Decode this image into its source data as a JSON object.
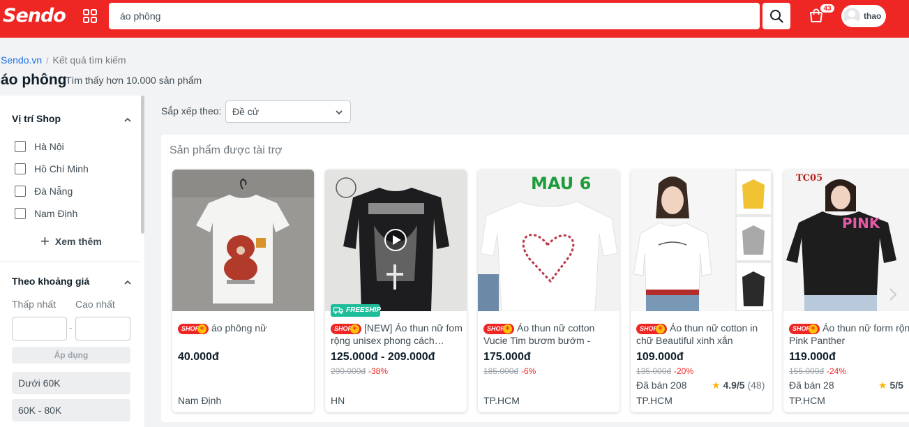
{
  "header": {
    "logo": "Sendo",
    "search_value": "áo phông",
    "cart_count": "43",
    "user_name": "thao"
  },
  "breadcrumb": {
    "home": "Sendo.vn",
    "sep": "/",
    "current": "Kết quả tìm kiếm"
  },
  "page": {
    "title": "áo phông",
    "result_count": "Tìm thấy hơn 10.000 sản phẩm"
  },
  "sidebar": {
    "location_title": "Vị trí Shop",
    "locations": [
      "Hà Nội",
      "Hồ Chí Minh",
      "Đà Nẵng",
      "Nam Định"
    ],
    "see_more": "Xem thêm",
    "price_title": "Theo khoảng giá",
    "min_label": "Thấp nhất",
    "max_label": "Cao nhất",
    "dash": "-",
    "apply": "Áp dụng",
    "ranges": [
      "Dưới 60K",
      "60K - 80K"
    ]
  },
  "sort": {
    "label": "Sắp xếp theo:",
    "value": "Đề cử"
  },
  "sponsored": {
    "title": "Sản phẩm được tài trợ",
    "shop_badge": "SHOP",
    "freeship": "FREESHIP",
    "products": [
      {
        "name": "áo phông nữ",
        "price": "40.000đ",
        "old_price": "",
        "discount": "",
        "sold": "",
        "rating": "",
        "reviews": "",
        "location": "Nam Định"
      },
      {
        "name": "[NEW] Áo thun nữ fom rộng unisex phong cách…",
        "price": "125.000đ - 209.000đ",
        "old_price": "290.000đ",
        "discount": "-38%",
        "sold": "",
        "rating": "",
        "reviews": "",
        "location": "HN"
      },
      {
        "name": "Áo thun nữ cotton Vucie Tim bươm bướm - Siz…",
        "price": "175.000đ",
        "old_price": "185.000đ",
        "discount": "-6%",
        "sold": "",
        "rating": "",
        "reviews": "",
        "location": "TP.HCM"
      },
      {
        "name": "Áo thun nữ cotton in chữ Beautiful xinh xắn",
        "price": "109.000đ",
        "old_price": "135.000đ",
        "discount": "-20%",
        "sold": "Đã bán 208",
        "rating": "4.9/5",
        "reviews": "(48)",
        "location": "TP.HCM"
      },
      {
        "name": "Áo thun nữ form rộng Pink Panther",
        "price": "119.000đ",
        "old_price": "155.000đ",
        "discount": "-24%",
        "sold": "Đã bán 28",
        "rating": "5/5",
        "reviews": "",
        "location": "TP.HCM"
      }
    ],
    "image_texts": {
      "p3": "MAU 6",
      "p5_code": "TC05",
      "p5_print": "PINK"
    }
  },
  "colors": {
    "brand": "#ee2624",
    "freeship": "#1dbd9a",
    "star": "#ffb400"
  }
}
